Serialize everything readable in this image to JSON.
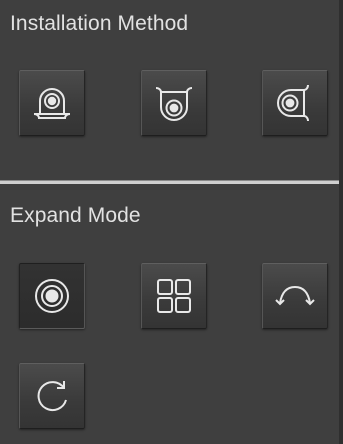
{
  "installation": {
    "title": "Installation Method",
    "buttons": [
      {
        "icon": "wall-mount-icon"
      },
      {
        "icon": "ceiling-mount-icon"
      },
      {
        "icon": "side-mount-icon"
      }
    ]
  },
  "expand": {
    "title": "Expand Mode",
    "buttons": [
      {
        "icon": "fisheye-view-icon",
        "active": true
      },
      {
        "icon": "quad-view-icon"
      },
      {
        "icon": "panorama-curve-icon"
      },
      {
        "icon": "rotate-icon"
      }
    ]
  },
  "colors": {
    "background": "#3f3f3f",
    "text": "#e2e2e2",
    "icon_stroke": "#e8e8e8",
    "divider": "#cfcfcf"
  }
}
